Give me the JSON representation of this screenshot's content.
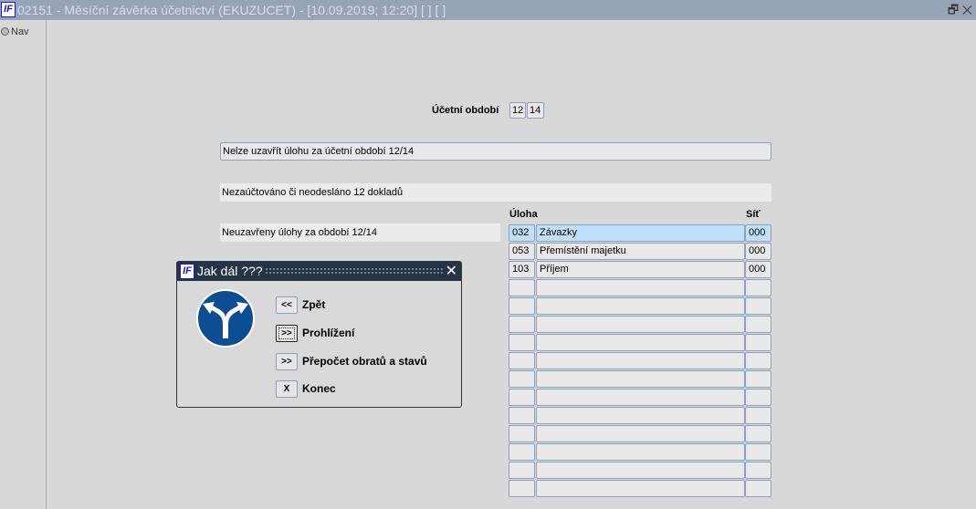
{
  "window": {
    "title": "02151 - Měsíční závěrka účetnictví (EKUZUCET) - [10.09.2019; 12:20]  [ ]  [ ]",
    "logo": "IF",
    "restore_icon": "🗗",
    "close_icon": "✕"
  },
  "nav": {
    "label": "Nav"
  },
  "period": {
    "label": "Účetní období",
    "month": "12",
    "year": "14"
  },
  "messages": {
    "error": "Nelze uzavřít úlohu za účetní období 12/14",
    "unposted": "Nezaúčtováno či neodesláno 12 dokladů",
    "open_tasks": "Neuzavřeny úlohy za období 12/14"
  },
  "grid": {
    "col_task": "Úloha",
    "col_net": "Síť",
    "rows": [
      {
        "code": "032",
        "name": "Závazky",
        "net": "000"
      },
      {
        "code": "053",
        "name": "Přemístění majetku",
        "net": "000"
      },
      {
        "code": "103",
        "name": "Příjem",
        "net": "000"
      },
      {
        "code": "",
        "name": "",
        "net": ""
      },
      {
        "code": "",
        "name": "",
        "net": ""
      },
      {
        "code": "",
        "name": "",
        "net": ""
      },
      {
        "code": "",
        "name": "",
        "net": ""
      },
      {
        "code": "",
        "name": "",
        "net": ""
      },
      {
        "code": "",
        "name": "",
        "net": ""
      },
      {
        "code": "",
        "name": "",
        "net": ""
      },
      {
        "code": "",
        "name": "",
        "net": ""
      },
      {
        "code": "",
        "name": "",
        "net": ""
      },
      {
        "code": "",
        "name": "",
        "net": ""
      },
      {
        "code": "",
        "name": "",
        "net": ""
      },
      {
        "code": "",
        "name": "",
        "net": ""
      }
    ]
  },
  "dialog": {
    "title": "Jak dál ???",
    "close": "✕",
    "buttons": [
      {
        "symbol": "<<",
        "label": "Zpět"
      },
      {
        "symbol": ">>",
        "label": "Prohlížení"
      },
      {
        "symbol": ">>",
        "label": "Přepočet obratů a stavů"
      },
      {
        "symbol": "X",
        "label": "Konec"
      }
    ]
  }
}
